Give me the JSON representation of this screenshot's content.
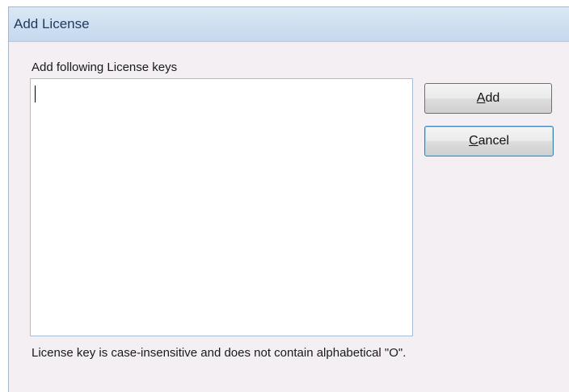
{
  "window": {
    "title": "Add License"
  },
  "form": {
    "prompt": "Add following License keys",
    "license_keys_value": "",
    "note": "License key is case-insensitive and does not contain alphabetical \"O\"."
  },
  "buttons": {
    "add_mnemonic": "A",
    "add_rest": "dd",
    "cancel_mnemonic": "C",
    "cancel_rest": "ancel"
  }
}
